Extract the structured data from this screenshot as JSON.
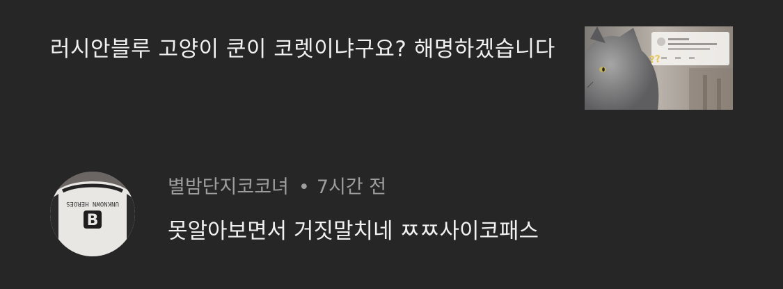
{
  "video": {
    "title": "러시안블루 고양이 쿤이 코렛이냐구요? 해명하겠습니다",
    "thumbnail_icon": "russian-blue-cat-thumbnail",
    "thumbnail_overlay": "??"
  },
  "comment": {
    "author": "별밤단지코코녀",
    "separator": "•",
    "time": "7시간 전",
    "text": "못알아보면서 거짓말치네 ㅉㅉ사이코패스",
    "avatar_icon": "user-avatar-shirt-b"
  }
}
